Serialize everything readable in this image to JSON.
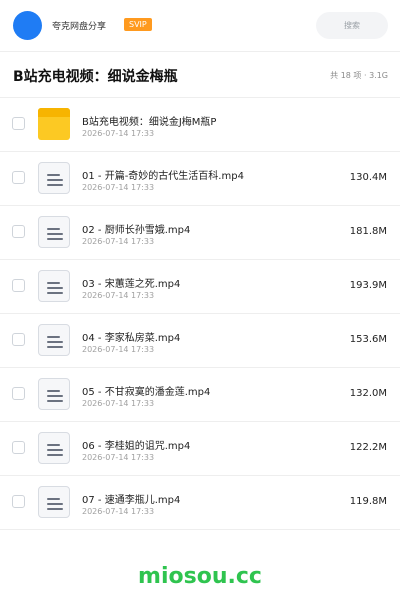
{
  "header": {
    "username": "夸克网盘分享",
    "badge": "SVIP",
    "search_placeholder": "搜索"
  },
  "folder": {
    "title": "B站充电视频：细说金梅瓶",
    "summary": "共 18 项 · 3.1G"
  },
  "items": [
    {
      "name": "B站充电视频：细说金J梅M瓶P",
      "date": "2026-07-14 17:33",
      "size": "",
      "type": "folder"
    },
    {
      "name": "01 - 开篇-奇妙的古代生活百科.mp4",
      "date": "2026-07-14 17:33",
      "size": "130.4M",
      "type": "file"
    },
    {
      "name": "02 - 厨师长孙雪娥.mp4",
      "date": "2026-07-14 17:33",
      "size": "181.8M",
      "type": "file"
    },
    {
      "name": "03 - 宋蕙莲之死.mp4",
      "date": "2026-07-14 17:33",
      "size": "193.9M",
      "type": "file"
    },
    {
      "name": "04 - 李家私房菜.mp4",
      "date": "2026-07-14 17:33",
      "size": "153.6M",
      "type": "file"
    },
    {
      "name": "05 - 不甘寂寞的潘金莲.mp4",
      "date": "2026-07-14 17:33",
      "size": "132.0M",
      "type": "file"
    },
    {
      "name": "06 - 李桂姐的诅咒.mp4",
      "date": "2026-07-14 17:33",
      "size": "122.2M",
      "type": "file"
    },
    {
      "name": "07 - 速通李瓶儿.mp4",
      "date": "2026-07-14 17:33",
      "size": "119.8M",
      "type": "file"
    }
  ],
  "footer": {
    "brand": "miosou.cc"
  },
  "colors": {
    "avatar": "#1f7cf4",
    "badge": "#ff9a1f",
    "folder": "#fcc923",
    "brand": "#2fc44f"
  },
  "icons": {
    "folder": "folder-icon",
    "file": "document-icon"
  }
}
